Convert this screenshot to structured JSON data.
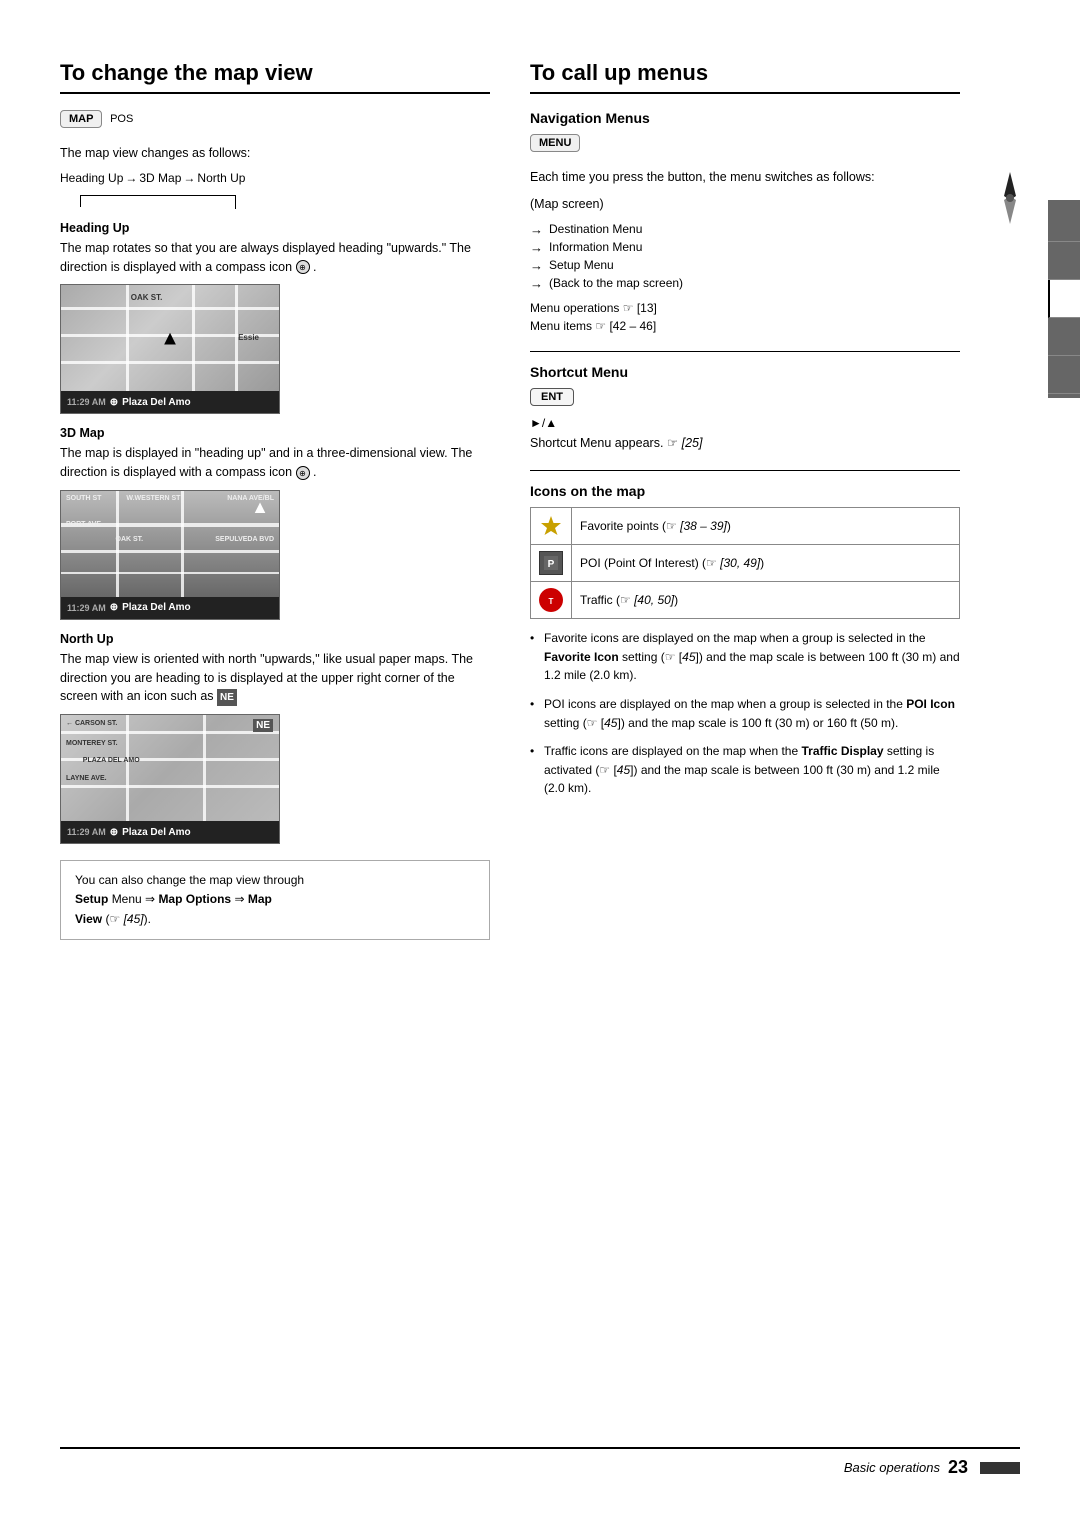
{
  "page": {
    "left_section": {
      "title": "To change the map view",
      "map_button": "MAP",
      "pos_label": "POS",
      "intro_text": "The map view changes as follows:",
      "sequence": {
        "items": [
          "Heading Up",
          "3D Map",
          "North Up"
        ],
        "arrows": [
          "→",
          "→"
        ]
      },
      "heading_up": {
        "label": "Heading Up",
        "description": "The map rotates so that you are always displayed heading \"upwards.\" The direction is displayed with a compass icon",
        "map_time": "11:29 AM",
        "map_compass": "▲",
        "map_title": "Plaza Del Amo"
      },
      "map_3d": {
        "label": "3D Map",
        "description": "The map is displayed in \"heading up\" and in a three-dimensional view. The direction is displayed with a compass icon",
        "map_time": "11:29 AM",
        "map_title": "Plaza Del Amo"
      },
      "north_up": {
        "label": "North Up",
        "description_1": "The map view is oriented with north \"upwards,\" like usual paper maps. The direction you are heading to is displayed at the upper right corner of the screen with an icon such as",
        "icon_label": "NE",
        "map_time": "11:29 AM",
        "map_title": "Plaza Del Amo"
      },
      "setup_box": {
        "prefix": "You can also change the map view through",
        "bold1": "Setup",
        "arrow1": "⇒",
        "bold2": "Map Options",
        "arrow2": "⇒",
        "bold3": "Map View",
        "ref": "(☞ [45])"
      }
    },
    "right_section": {
      "title": "To call up menus",
      "nav_menus": {
        "title": "Navigation Menus",
        "button": "MENU",
        "intro": "Each time you press the button, the menu switches as follows:",
        "map_screen": "(Map screen)",
        "items": [
          "→ Destination Menu",
          "→ Information Menu",
          "→ Setup Menu",
          "→ (Back to the map screen)"
        ],
        "ref1": "Menu operations ☞ [13]",
        "ref2": "Menu items ☞ [42 – 46]"
      },
      "shortcut_menu": {
        "title": "Shortcut Menu",
        "button": "ENT",
        "symbol": "►/▲",
        "description": "Shortcut Menu appears.",
        "ref": "☞ [25]"
      },
      "icons_on_map": {
        "title": "Icons on the map",
        "rows": [
          {
            "icon_type": "star",
            "text": "Favorite points (☞ [38 – 39])"
          },
          {
            "icon_type": "poi",
            "text": "POI (Point Of Interest) (☞ [30, 49])"
          },
          {
            "icon_type": "traffic",
            "text": "Traffic (☞ [40, 50])"
          }
        ],
        "bullets": [
          {
            "text_parts": [
              {
                "text": "Favorite icons are displayed on the map when a group is selected in the ",
                "bold": false
              },
              {
                "text": "Favorite Icon",
                "bold": true
              },
              {
                "text": " setting (☞ [45]) and the map scale is between 100 ft (30 m) and 1.2 mile (2.0 km).",
                "bold": false
              }
            ]
          },
          {
            "text_parts": [
              {
                "text": "POI icons are displayed on the map when a group is selected in the ",
                "bold": false
              },
              {
                "text": "POI Icon",
                "bold": true
              },
              {
                "text": " setting (☞ [45]) and the map scale is 100 ft (30 m) or 160 ft (50 m).",
                "bold": false
              }
            ]
          },
          {
            "text_parts": [
              {
                "text": "Traffic icons are displayed on the map when the ",
                "bold": false
              },
              {
                "text": "Traffic Display",
                "bold": true
              },
              {
                "text": " setting is activated (☞ [45]) and the map scale is between 100 ft (30 m) and 1.2 mile (2.0 km).",
                "bold": false
              }
            ]
          }
        ]
      }
    },
    "footer": {
      "italic_text": "Basic operations",
      "page_number": "23"
    }
  }
}
